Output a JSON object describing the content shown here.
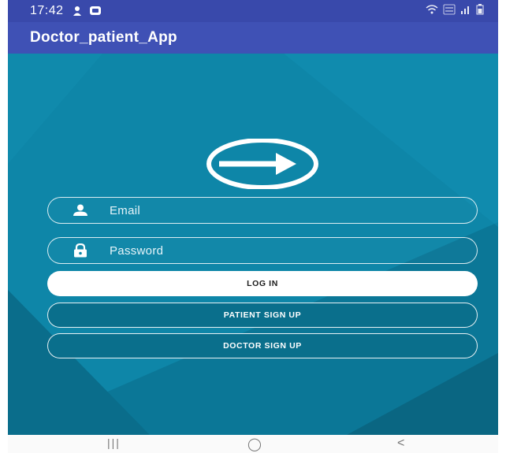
{
  "status_bar": {
    "time": "17:42",
    "left_icons": [
      "person-location-icon",
      "message-icon"
    ],
    "right_icons": [
      "wifi-icon",
      "volte-lte-icon",
      "signal-icon",
      "battery-icon"
    ],
    "volte_label": "Vo))\nLTE1"
  },
  "app_bar": {
    "title": "Doctor_patient_App"
  },
  "login_form": {
    "logo_icon": "login-arrow-circle-icon",
    "email": {
      "placeholder": "Email",
      "icon": "person-icon"
    },
    "password": {
      "placeholder": "Password",
      "icon": "lock-icon"
    },
    "login_label": "LOG IN",
    "patient_signup_label": "PATIENT SIGN UP",
    "doctor_signup_label": "DOCTOR SIGN UP"
  },
  "nav_bar": {
    "recents": "|||",
    "home": "◯",
    "back": "<"
  },
  "colors": {
    "status_bar": "#3949ab",
    "app_bar": "#3f51b5",
    "background": "#0e86a8",
    "background_dark": "#0b6f8d",
    "outline_button": "#0a6f8c",
    "login_button": "#ffffff"
  }
}
